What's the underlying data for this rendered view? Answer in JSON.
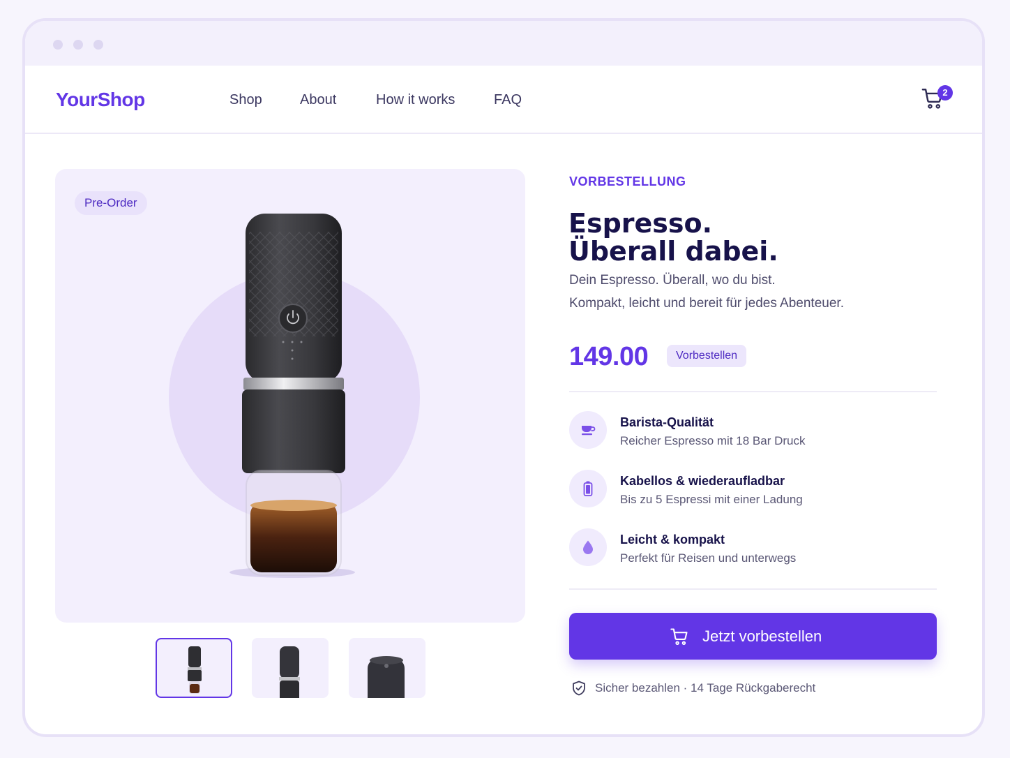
{
  "colors": {
    "accent": "#6236e6",
    "heading": "#17124a",
    "body_text": "#4d4a6b",
    "hero_background": "#f3effd",
    "page_background": "#f7f5fd"
  },
  "window": {
    "controls": [
      "dot",
      "dot",
      "dot"
    ]
  },
  "navbar": {
    "logo": "YourShop",
    "links": [
      {
        "label": "Shop"
      },
      {
        "label": "About"
      },
      {
        "label": "How it works"
      },
      {
        "label": "FAQ"
      }
    ],
    "cart": {
      "icon": "cart-icon",
      "count": "2"
    }
  },
  "gallery": {
    "badge": "Pre-Order",
    "main_image": "portable-espresso-maker",
    "thumbnails": [
      {
        "icon": "espresso-maker-front-thumb",
        "active": true
      },
      {
        "icon": "espresso-maker-side-thumb",
        "active": false
      },
      {
        "icon": "espresso-maker-top-thumb",
        "active": false
      }
    ]
  },
  "product": {
    "eyebrow": "VORBESTELLUNG",
    "headline_line1": "Espresso.",
    "headline_line2": "Überall dabei.",
    "subtitle_line1": "Dein Espresso. Überall, wo du bist.",
    "subtitle_line2": "Kompakt, leicht und bereit für jedes Abenteuer.",
    "price": "149.00",
    "price_badge": "Vorbestellen"
  },
  "features": [
    {
      "icon": "coffee-cup-icon",
      "title": "Barista-Qualität",
      "description": "Reicher Espresso mit 18 Bar Druck"
    },
    {
      "icon": "battery-icon",
      "title": "Kabellos & wiederaufladbar",
      "description": "Bis zu 5 Espressi mit einer Ladung"
    },
    {
      "icon": "droplet-icon",
      "title": "Leicht & kompakt",
      "description": "Perfekt für Reisen und unterwegs"
    }
  ],
  "cta": {
    "icon": "cart-icon",
    "label": "Jetzt vorbestellen"
  },
  "trust": {
    "icon": "shield-check-icon",
    "text": "Sicher bezahlen · 14 Tage Rückgaberecht"
  }
}
